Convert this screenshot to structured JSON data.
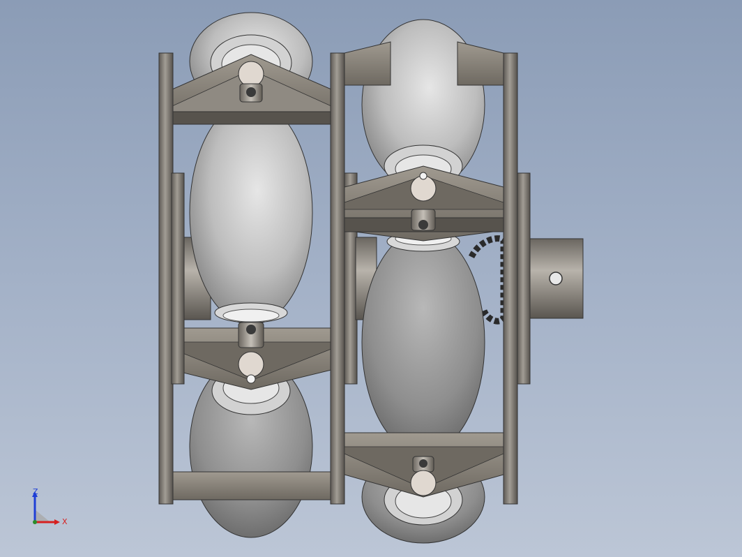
{
  "view": {
    "background_top": "#8b9cb6",
    "background_bottom": "#bcc6d6",
    "part_color": "#8f8a82",
    "roller_color": "#c8c8c8"
  },
  "triad": {
    "z_label": "Z",
    "x_label": "X",
    "z_color": "#1f3fd6",
    "x_color": "#d62020"
  }
}
